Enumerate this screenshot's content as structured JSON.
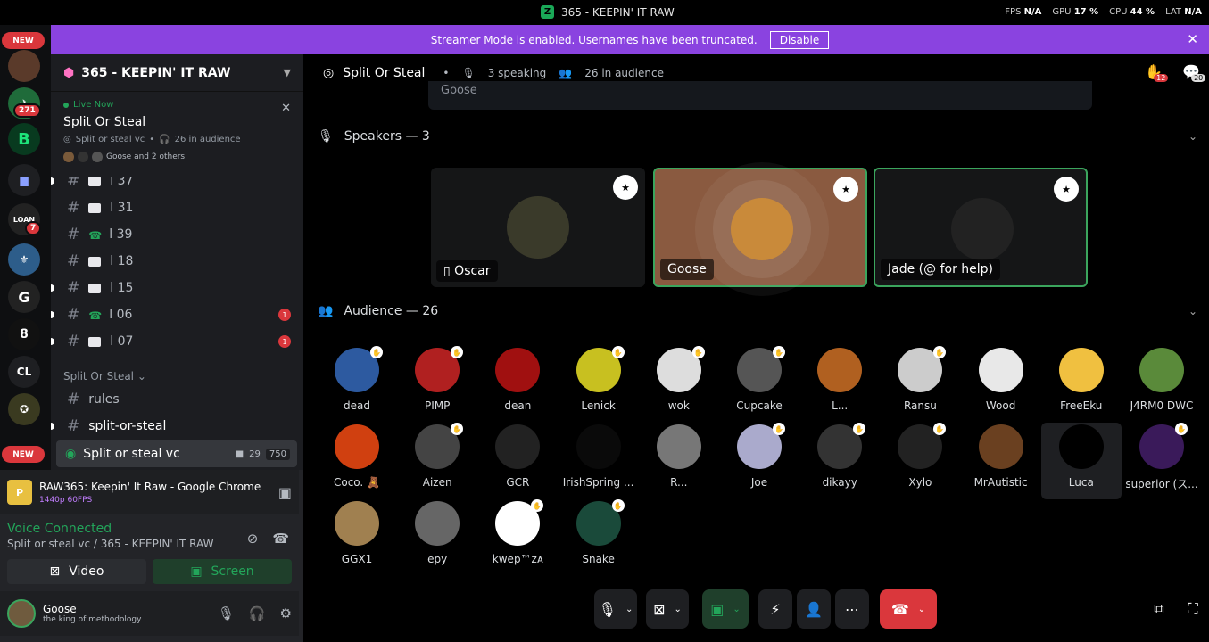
{
  "titlebar": {
    "title": "365 - KEEPIN' IT RAW",
    "fps_label": "FPS",
    "fps_value": "N/A",
    "gpu_label": "GPU",
    "gpu_value": "17 %",
    "cpu_label": "CPU",
    "cpu_value": "44 %",
    "lat_label": "LAT",
    "lat_value": "N/A"
  },
  "banner": {
    "text": "Streamer Mode is enabled. Usernames have been truncated.",
    "button": "Disable"
  },
  "rail": {
    "new_top": "NEW",
    "new_bottom": "NEW",
    "badge_271": "271",
    "badge_7": "7",
    "cl": "CL",
    "loan": "LOAN"
  },
  "guild": {
    "name": "365 - KEEPIN' IT RAW"
  },
  "live": {
    "label": "Live Now",
    "name": "Split Or Steal",
    "channel": "Split or steal vc",
    "audience": "26 in audience",
    "who": "Goose and 2 others"
  },
  "channels": [
    {
      "name": "l 37",
      "badge": ""
    },
    {
      "name": "l 31",
      "badge": ""
    },
    {
      "name": "l 39",
      "badge": ""
    },
    {
      "name": "l 18",
      "badge": ""
    },
    {
      "name": "l 15",
      "badge": ""
    },
    {
      "name": "l 06",
      "badge": "1"
    },
    {
      "name": "l 07",
      "badge": "1"
    }
  ],
  "category": "Split Or Steal",
  "text_channels": [
    "rules",
    "split-or-steal"
  ],
  "voice_channel": {
    "name": "Split or steal vc",
    "video_count": "29",
    "audience": "750",
    "sub": "Split Or Steal"
  },
  "stream": {
    "title": "RAW365: Keepin' It Raw - Google Chrome",
    "quality": "1440p 60FPS",
    "icon": "P"
  },
  "voice": {
    "status": "Voice Connected",
    "channel": "Split or steal vc / 365 - KEEPIN' IT RAW",
    "video_label": "Video",
    "screen_label": "Screen"
  },
  "user": {
    "name": "Goose",
    "status": "the king of methodology"
  },
  "stage": {
    "name": "Split Or Steal",
    "speaking": "3 speaking",
    "audience": "26 in audience",
    "raised": "12",
    "listeners": "20",
    "thumb_name": "Goose"
  },
  "speakers_label": "Speakers — 3",
  "speakers": [
    {
      "name": "Oscar"
    },
    {
      "name": "Goose"
    },
    {
      "name": "Jade (@ for help)"
    }
  ],
  "audience_label": "Audience — 26",
  "audience": [
    "dead",
    "PIMP",
    "dean",
    "Lenick",
    "wok",
    "Cupcake",
    "L...",
    "Ransu",
    "Wood",
    "FreeEku",
    "J4RM0 DWC",
    "Coco. 🧸",
    "Aizen",
    "GCR",
    "IrishSpring ...",
    "R...",
    "Joe",
    "dikayy",
    "Xylo",
    "MrAutistic",
    "Luca",
    "superior (ス...",
    "GGX1",
    "epy",
    "kwep™ᴢᴀ",
    "Snake"
  ],
  "colors": {
    "accent": "#8a43e0",
    "green": "#23a55a",
    "red": "#da373c"
  }
}
